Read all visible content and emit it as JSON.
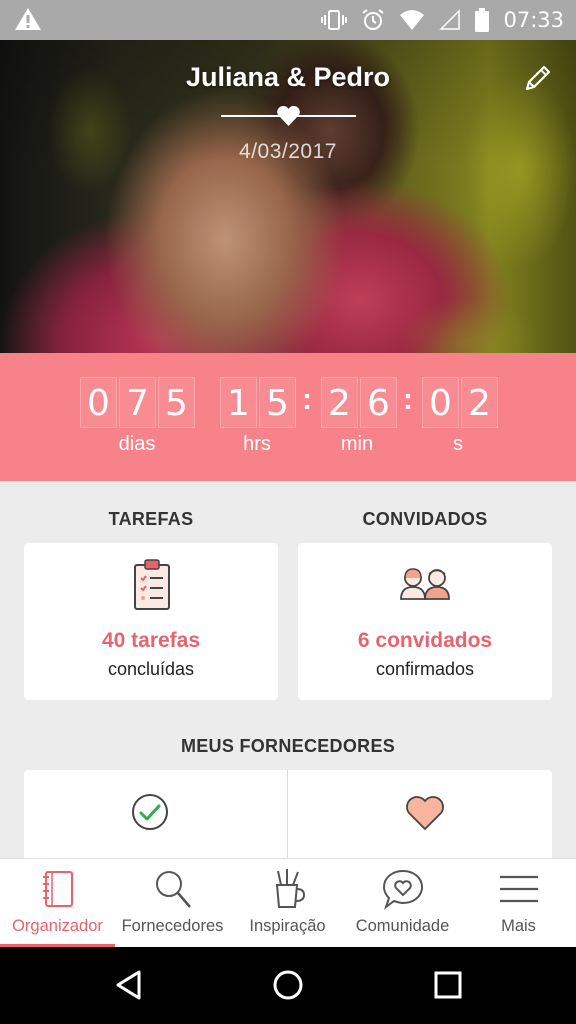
{
  "status_bar": {
    "time": "07:33"
  },
  "hero": {
    "couple_names": "Juliana & Pedro",
    "wedding_date": "4/03/2017"
  },
  "countdown": {
    "days_digits": [
      "0",
      "7",
      "5"
    ],
    "hours_digits": [
      "1",
      "5"
    ],
    "minutes_digits": [
      "2",
      "6"
    ],
    "seconds_digits": [
      "0",
      "2"
    ],
    "labels": {
      "days": "dias",
      "hours": "hrs",
      "minutes": "min",
      "seconds": "s"
    }
  },
  "tasks": {
    "title": "TAREFAS",
    "count_text": "40 tarefas",
    "status_text": "concluídas"
  },
  "guests": {
    "title": "CONVIDADOS",
    "count_text": "6 convidados",
    "status_text": "confirmados"
  },
  "vendors": {
    "title": "MEUS FORNECEDORES"
  },
  "bottom_nav": {
    "items": [
      {
        "label": "Organizador",
        "icon": "notebook-icon",
        "active": true
      },
      {
        "label": "Fornecedores",
        "icon": "search-icon",
        "active": false
      },
      {
        "label": "Inspiração",
        "icon": "cup-pencils-icon",
        "active": false
      },
      {
        "label": "Comunidade",
        "icon": "chat-heart-icon",
        "active": false
      },
      {
        "label": "Mais",
        "icon": "menu-icon",
        "active": false
      }
    ]
  },
  "colors": {
    "accent": "#e8646c",
    "countdown_bg": "#f88289",
    "status_bar": "#a9a9a9"
  }
}
